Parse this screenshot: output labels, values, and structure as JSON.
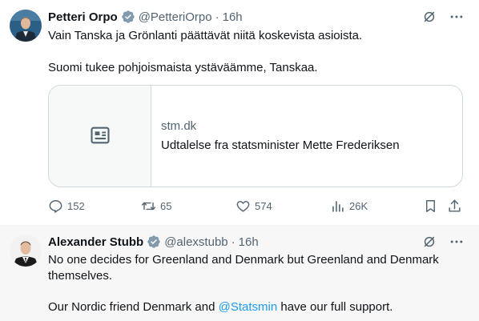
{
  "tweets": [
    {
      "author_name": "Petteri Orpo",
      "handle": "@PetteriOrpo",
      "separator": "·",
      "time": "16h",
      "line1": "Vain Tanska ja Grönlanti päättävät niitä koskevista asioista.",
      "line2": "Suomi tukee pohjoismaista ystäväämme, Tanskaa.",
      "card": {
        "domain": "stm.dk",
        "title": "Udtalelse fra statsminister Mette Frederiksen",
        "icon": "article-icon"
      },
      "actions": {
        "replies": "152",
        "reposts": "65",
        "likes": "574",
        "views": "26K"
      }
    },
    {
      "author_name": "Alexander Stubb",
      "handle": "@alexstubb",
      "separator": "·",
      "time": "16h",
      "line1": "No one decides for Greenland and Denmark but Greenland and Denmark",
      "line2": "themselves.",
      "line3_before": "Our Nordic friend Denmark and ",
      "line3_mention": "@Statsmin",
      "line3_after": " have our full support."
    }
  ],
  "colors": {
    "accent": "#1d9bf0",
    "verified": "#829aab",
    "muted": "#536471",
    "border": "#cfd9de"
  },
  "icons": [
    "verified-icon",
    "grok-icon",
    "more-icon",
    "reply-icon",
    "repost-icon",
    "like-icon",
    "views-icon",
    "bookmark-icon",
    "share-icon"
  ]
}
